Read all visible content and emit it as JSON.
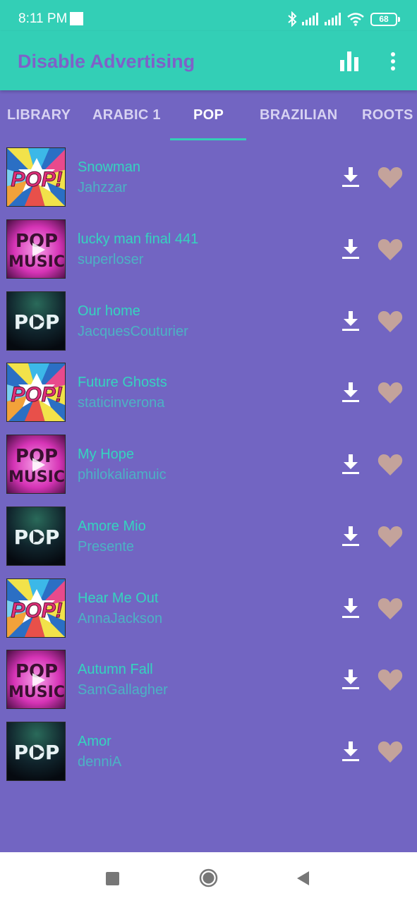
{
  "status_bar": {
    "time": "8:11 PM",
    "battery": "68"
  },
  "app_bar": {
    "title": "Disable Advertising"
  },
  "tabs": [
    {
      "label": "LIBRARY",
      "active": false
    },
    {
      "label": "ARABIC 1",
      "active": false
    },
    {
      "label": "POP",
      "active": true
    },
    {
      "label": "BRAZILIAN",
      "active": false
    },
    {
      "label": "ROOTS",
      "active": false
    }
  ],
  "thumbnail_text": {
    "pop_burst": "POP!",
    "pop_music_line1": "POP",
    "pop_music_line2": "MUSIC",
    "pop_dark": "POP"
  },
  "tracks": [
    {
      "title": "Snowman",
      "artist": "Jahzzar",
      "thumbnail": "pop-burst"
    },
    {
      "title": "lucky man final 441",
      "artist": "superloser",
      "thumbnail": "pop-music-pink"
    },
    {
      "title": "Our home",
      "artist": "JacquesCouturier",
      "thumbnail": "pop-dark"
    },
    {
      "title": "Future Ghosts",
      "artist": "staticinverona",
      "thumbnail": "pop-burst"
    },
    {
      "title": "My Hope",
      "artist": "philokaliamuic",
      "thumbnail": "pop-music-pink"
    },
    {
      "title": "Amore Mio",
      "artist": "Presente",
      "thumbnail": "pop-dark"
    },
    {
      "title": "Hear Me Out",
      "artist": "AnnaJackson",
      "thumbnail": "pop-burst"
    },
    {
      "title": "Autumn Fall",
      "artist": "SamGallagher",
      "thumbnail": "pop-music-pink"
    },
    {
      "title": "Amor",
      "artist": "denniA",
      "thumbnail": "pop-dark"
    }
  ],
  "icons": {
    "status": [
      "bluetooth-icon",
      "signal-icon",
      "signal-icon",
      "wifi-icon",
      "battery-icon"
    ],
    "app_bar": [
      "equalizer-icon",
      "more-vert-icon"
    ],
    "row": [
      "download-icon",
      "heart-icon"
    ],
    "nav": [
      "recent-apps-icon",
      "home-icon",
      "back-icon"
    ]
  },
  "colors": {
    "app_bar": "#33cfb6",
    "background": "#7265c2",
    "title_text": "#7f61c8",
    "track_title": "#35d4bf",
    "track_artist": "#4cb2c4",
    "heart": "#c4a39b",
    "tab_indicator": "#33cfb6"
  }
}
